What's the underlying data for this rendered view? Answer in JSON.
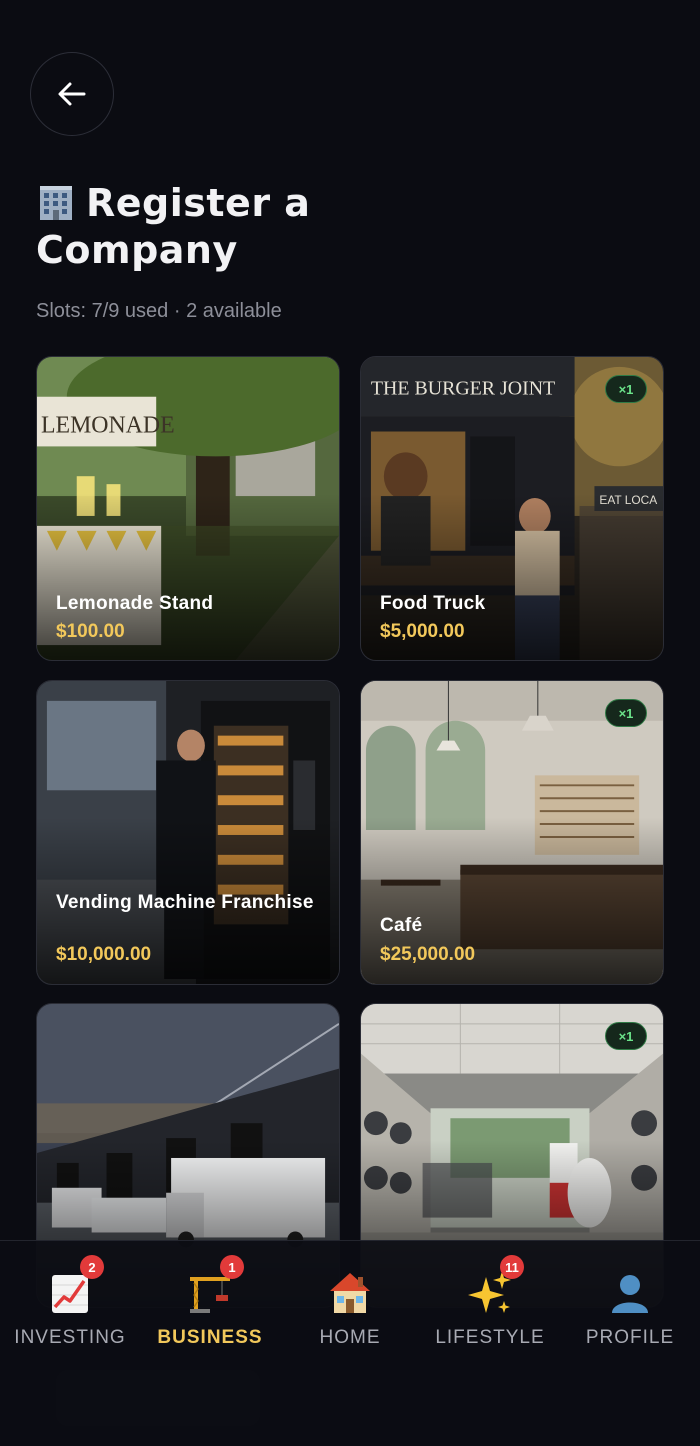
{
  "header": {
    "title": "Register a Company",
    "slots_text": "Slots: 7/9 used · 2 available"
  },
  "companies": [
    {
      "name": "Lemonade Stand",
      "price": "$100.00",
      "badge": ""
    },
    {
      "name": "Food Truck",
      "price": "$5,000.00",
      "badge": "×1"
    },
    {
      "name": "Vending Machine Franchise",
      "price": "$10,000.00",
      "badge": ""
    },
    {
      "name": "Café",
      "price": "$25,000.00",
      "badge": "×1"
    },
    {
      "name": "",
      "price": "",
      "badge": ""
    },
    {
      "name": "",
      "price": "",
      "badge": "×1"
    }
  ],
  "nav": [
    {
      "label": "INVESTING",
      "badge": "2",
      "icon": "chart-icon"
    },
    {
      "label": "BUSINESS",
      "badge": "1",
      "icon": "crane-icon"
    },
    {
      "label": "HOME",
      "badge": "",
      "icon": "house-icon"
    },
    {
      "label": "LIFESTYLE",
      "badge": "11",
      "icon": "sparkles-icon"
    },
    {
      "label": "PROFILE",
      "badge": "",
      "icon": "person-icon"
    }
  ],
  "colors": {
    "background": "#0b0c12",
    "accent_gold": "#f2c85b",
    "badge_green": "#6be38a",
    "notification_red": "#e23a3a"
  }
}
